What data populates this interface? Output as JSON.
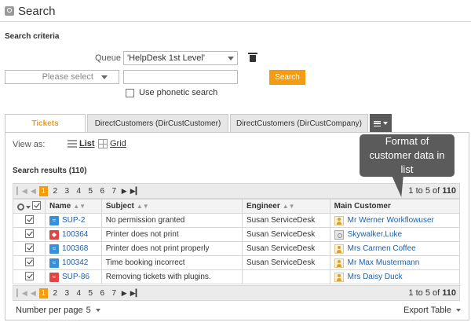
{
  "header": {
    "title": "Search",
    "icon": "search-icon"
  },
  "criteria": {
    "label": "Search criteria",
    "queue_label": "Queue",
    "queue_value": "'HelpDesk 1st Level'",
    "field_placeholder": "Please select",
    "text_value": "",
    "search_button": "Search",
    "phonetic_label": "Use phonetic search"
  },
  "tabs": [
    {
      "label": "Tickets",
      "active": true
    },
    {
      "label": "DirectCustomers (DirCustCustomer)",
      "active": false
    },
    {
      "label": "DirectCustomers (DirCustCompany)",
      "active": false
    }
  ],
  "view": {
    "label": "View as:",
    "list": "List",
    "grid": "Grid"
  },
  "results": {
    "label": "Search results (110)"
  },
  "pager": {
    "pages": [
      "1",
      "2",
      "3",
      "4",
      "5",
      "6",
      "7"
    ],
    "current": "1",
    "info_prefix": "1 to 5",
    "info_of": " of ",
    "info_total": "110"
  },
  "table": {
    "columns": {
      "name": "Name",
      "subject": "Subject",
      "engineer": "Engineer",
      "customer": "Main Customer"
    },
    "rows": [
      {
        "name": "SUP-2",
        "subject": "No permission granted",
        "engineer": "Susan ServiceDesk",
        "customer": "Mr Werner Workflowuser",
        "type": "blue",
        "customer_icon": "person-icon"
      },
      {
        "name": "100364",
        "subject": "Printer does not print",
        "engineer": "Susan ServiceDesk",
        "customer": "Skywalker,Luke",
        "type": "red",
        "customer_icon": "company-icon"
      },
      {
        "name": "100368",
        "subject": "Printer does not print properly",
        "engineer": "Susan ServiceDesk",
        "customer": "Mrs Carmen Coffee",
        "type": "blue",
        "customer_icon": "person-icon"
      },
      {
        "name": "100342",
        "subject": "Time booking incorrect",
        "engineer": "Susan ServiceDesk",
        "customer": "Mr Max Mustermann",
        "type": "blue",
        "customer_icon": "person-icon"
      },
      {
        "name": "SUP-86",
        "subject": "Removing tickets with plugins.",
        "engineer": "",
        "customer": "Mrs Daisy Duck",
        "type": "red",
        "customer_icon": "person-icon"
      }
    ]
  },
  "footer": {
    "per_page_label": "Number per page",
    "per_page_value": "5",
    "export_label": "Export Table"
  },
  "callout": {
    "text": "Format of customer data in list"
  },
  "colors": {
    "accent": "#f39c12",
    "link": "#1f5fa8",
    "callout": "#5b5b5b"
  }
}
